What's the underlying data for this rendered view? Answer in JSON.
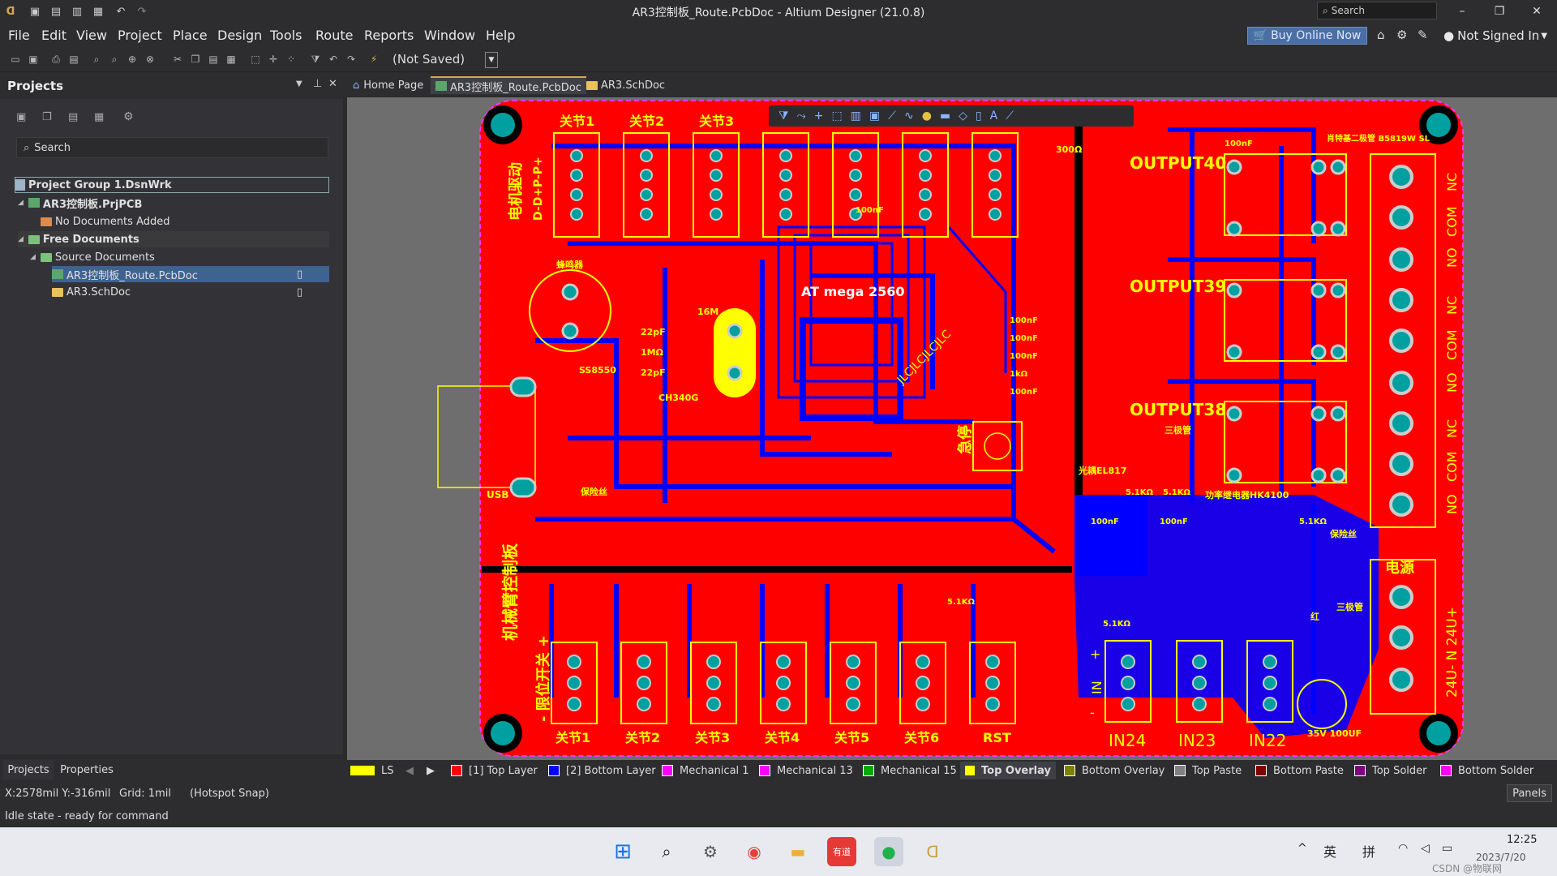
{
  "window": {
    "title": "AR3控制板_Route.PcbDoc - Altium Designer (21.0.8)",
    "search_placeholder": "Search",
    "minimize": "–",
    "maximize": "❐",
    "close": "✕"
  },
  "menu": [
    "File",
    "Edit",
    "View",
    "Project",
    "Place",
    "Design",
    "Tools",
    "Route",
    "Reports",
    "Window",
    "Help"
  ],
  "header_right": {
    "buy_online": "Buy Online Now",
    "signed_in": "Not Signed In"
  },
  "toolbar": {
    "not_saved": "(Not Saved)"
  },
  "projects_panel": {
    "title": "Projects",
    "search_placeholder": "Search",
    "tree": [
      {
        "label": "Project Group 1.DsnWrk",
        "level": 0,
        "bold": true
      },
      {
        "label": "AR3控制板.PrjPCB",
        "level": 1,
        "bold": true
      },
      {
        "label": "No Documents Added",
        "level": 2,
        "bold": false
      },
      {
        "label": "Free Documents",
        "level": 1,
        "bold": true
      },
      {
        "label": "Source Documents",
        "level": 2,
        "bold": false
      },
      {
        "label": "AR3控制板_Route.PcbDoc",
        "level": 3,
        "bold": false,
        "selected": true
      },
      {
        "label": "AR3.SchDoc",
        "level": 3,
        "bold": false
      }
    ],
    "bottom_tabs": [
      "Projects",
      "Properties"
    ]
  },
  "doc_tabs": [
    {
      "label": "Home Page"
    },
    {
      "label": "AR3控制板_Route.PcbDoc",
      "active": true
    },
    {
      "label": "AR3.SchDoc"
    }
  ],
  "pcb": {
    "labels_top_relays": [
      "关节1",
      "关节2",
      "关节3"
    ],
    "labels_bottom": [
      "关节1",
      "关节2",
      "关节3",
      "关节4",
      "关节5",
      "关节6",
      "RST"
    ],
    "outputs": [
      "OUTPUT40",
      "OUTPUT39",
      "OUTPUT38"
    ],
    "inputs": [
      "IN24",
      "IN23",
      "IN22"
    ],
    "mcu": "AT mega 2560",
    "left_vertical_1": "电机驱动",
    "left_vertical_2": "D-D+P-P+",
    "left_vertical_3": "机械臂控制板",
    "left_vertical_4": "- 限位开关 +",
    "power": "电源",
    "usb": "USB",
    "buzzer": "蜂鸣器",
    "ss8550": "SS8550",
    "ch340g": "CH340G",
    "fuse": "保险丝",
    "crystal": "16M",
    "estop": "急停",
    "optocoupler": "光耦EL817",
    "relay": "功率继电器HK4100",
    "schottky": "肖特基二极管\nB5819W SL",
    "cap_big": "35V 100UF",
    "jlc": "JLCJLCJLCJLC",
    "r300": "300Ω",
    "triode": "三极管",
    "red": "红",
    "terminal_right": [
      "NC",
      "COM",
      "NO",
      "NC",
      "COM",
      "NO",
      "NC",
      "COM",
      "NO"
    ],
    "terminal_power": "24U- N 24U+",
    "caps": [
      "100nF",
      "100nF",
      "100nF",
      "100nF",
      "100nF",
      "100nF",
      "100nF",
      "100nF"
    ],
    "cap_22p": "22pF",
    "res_1m": "1MΩ",
    "res_1k": "1kΩ",
    "res_51k": "5.1KΩ",
    "in_sign_plus": "+",
    "in_sign_in": "IN",
    "in_sign_minus": "-"
  },
  "layers": [
    {
      "label": "LS",
      "color": "#ffff00"
    },
    {
      "label": "[1] Top Layer",
      "color": "#ff0000"
    },
    {
      "label": "[2] Bottom Layer",
      "color": "#0000ff"
    },
    {
      "label": "Mechanical 1",
      "color": "#ff00ff"
    },
    {
      "label": "Mechanical 13",
      "color": "#ff00ff"
    },
    {
      "label": "Mechanical 15",
      "color": "#00aa00"
    },
    {
      "label": "Top Overlay",
      "color": "#ffff00",
      "active": true
    },
    {
      "label": "Bottom Overlay",
      "color": "#808000"
    },
    {
      "label": "Top Paste",
      "color": "#808080"
    },
    {
      "label": "Bottom Paste",
      "color": "#800000"
    },
    {
      "label": "Top Solder",
      "color": "#800080"
    },
    {
      "label": "Bottom Solder",
      "color": "#ff00ff"
    }
  ],
  "status": {
    "coords": "X:2578mil Y:-316mil",
    "grid": "Grid: 1mil",
    "snap": "(Hotspot Snap)",
    "idle": "Idle state - ready for command",
    "panels": "Panels"
  },
  "taskbar": {
    "time": "12:25",
    "date": "2023/7/20",
    "ime1": "英",
    "ime2": "拼",
    "watermark": "CSDN @物联网",
    "caret": "^"
  }
}
